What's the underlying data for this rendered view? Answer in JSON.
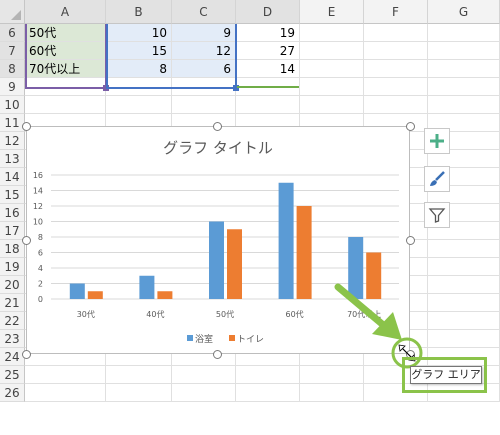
{
  "columns": [
    "A",
    "B",
    "C",
    "D",
    "E",
    "F",
    "G"
  ],
  "rows": [
    "6",
    "7",
    "8",
    "9",
    "10",
    "11",
    "12",
    "13",
    "14",
    "15",
    "16",
    "17",
    "18",
    "19",
    "20",
    "21",
    "22",
    "23",
    "24",
    "25",
    "26"
  ],
  "table": [
    [
      "50代",
      "10",
      "9",
      "19"
    ],
    [
      "60代",
      "15",
      "12",
      "27"
    ],
    [
      "70代以上",
      "8",
      "6",
      "14"
    ]
  ],
  "chart_data": {
    "type": "bar",
    "title": "グラフ タイトル",
    "categories": [
      "30代",
      "40代",
      "50代",
      "60代",
      "70代以上"
    ],
    "series": [
      {
        "name": "浴室",
        "values": [
          2,
          3,
          10,
          15,
          8
        ],
        "color": "#5b9bd5"
      },
      {
        "name": "トイレ",
        "values": [
          1,
          1,
          9,
          12,
          6
        ],
        "color": "#ed7d31"
      }
    ],
    "ylim": [
      0,
      16
    ],
    "yticks": [
      "0",
      "2",
      "4",
      "6",
      "8",
      "10",
      "12",
      "14",
      "16"
    ],
    "grid": true,
    "legend": "bottom"
  },
  "side_buttons": [
    {
      "name": "chart-elements-button",
      "icon": "plus-icon"
    },
    {
      "name": "chart-styles-button",
      "icon": "brush-icon"
    },
    {
      "name": "chart-filters-button",
      "icon": "funnel-icon"
    }
  ],
  "tooltip": "グラフ エリア",
  "colors": {
    "accent_green": "#8bc34a",
    "selection_purple": "#7b5ea7",
    "selection_blue": "#4472c4",
    "selection_green": "#70ad47"
  }
}
